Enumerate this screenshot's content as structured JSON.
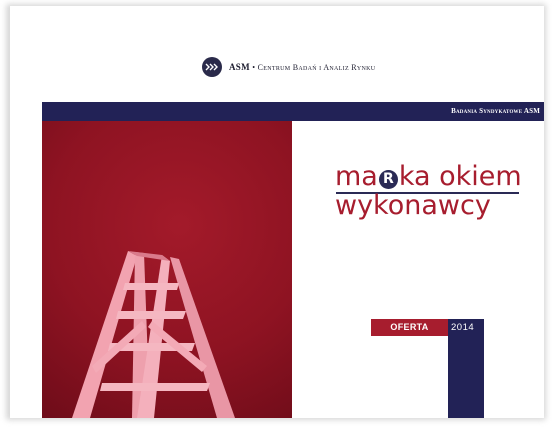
{
  "header": {
    "logo_name": "ASM",
    "logo_separator": "•",
    "logo_tagline": "Centrum Badań i Analiz Rynku",
    "logo_icon": "asm-arrows-icon"
  },
  "navbar": {
    "label": "Badania Syndykatowe ASM"
  },
  "title": {
    "line1_prefix": "ma",
    "line1_mark": "R",
    "line1_suffix": "ka okiem",
    "line2": "wykonawcy"
  },
  "badge": {
    "label": "OFERTA",
    "year": "2014"
  },
  "colors": {
    "navy": "#222256",
    "crimson": "#a71d2e",
    "background": "#ffffff"
  }
}
